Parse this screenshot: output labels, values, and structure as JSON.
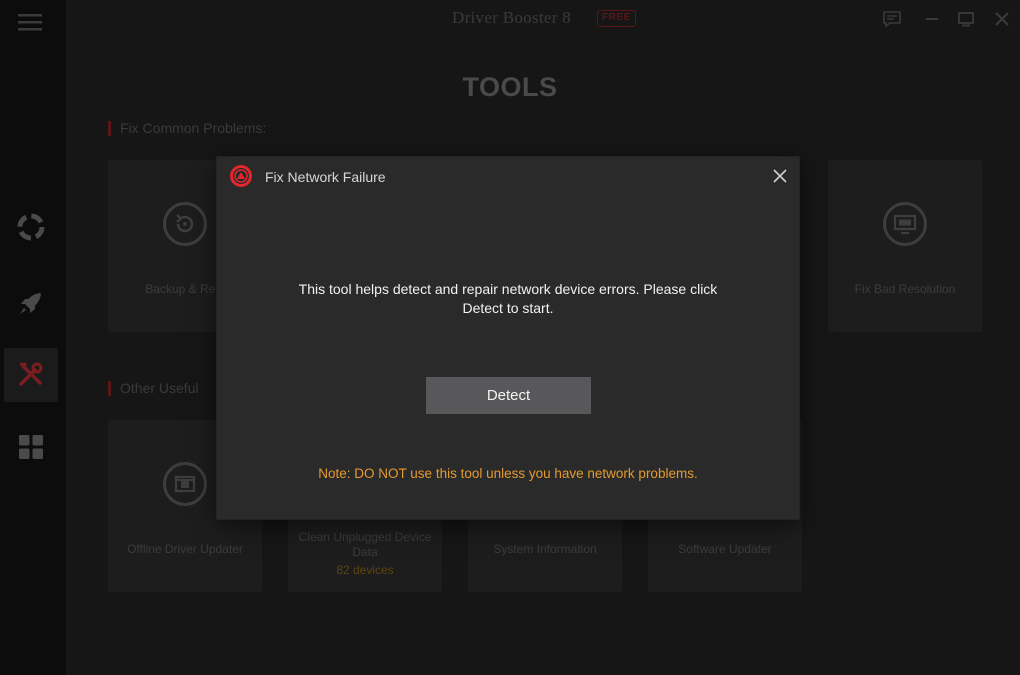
{
  "app": {
    "title": "Driver Booster 8",
    "badge": "FREE",
    "page_title": "TOOLS"
  },
  "sidebar": {
    "items": [
      {
        "icon": "lifebuoy-icon"
      },
      {
        "icon": "rocket-icon"
      },
      {
        "icon": "tools-icon",
        "active": true
      },
      {
        "icon": "grid-icon"
      }
    ]
  },
  "sections": {
    "common": "Fix Common Problems:",
    "other": "Other Useful"
  },
  "cards": {
    "backup": "Backup & Rest",
    "bad_resolution": "Fix Bad Resolution",
    "offline_updater": "Offline Driver Updater",
    "clean_unplugged": "Clean Unplugged Device Data",
    "clean_unplugged_count": "82 devices",
    "system_info": "System Information",
    "software_updater": "Software Updater"
  },
  "modal": {
    "title": "Fix Network Failure",
    "message": "This tool helps detect and repair network device errors. Please click Detect to start.",
    "button": "Detect",
    "note": "Note: DO NOT use this tool unless you have network problems."
  },
  "colors": {
    "accent_red": "#e2262c",
    "note_orange": "#e59a2e",
    "modal_bg": "#2a2a2b",
    "button_bg": "#58585a"
  }
}
